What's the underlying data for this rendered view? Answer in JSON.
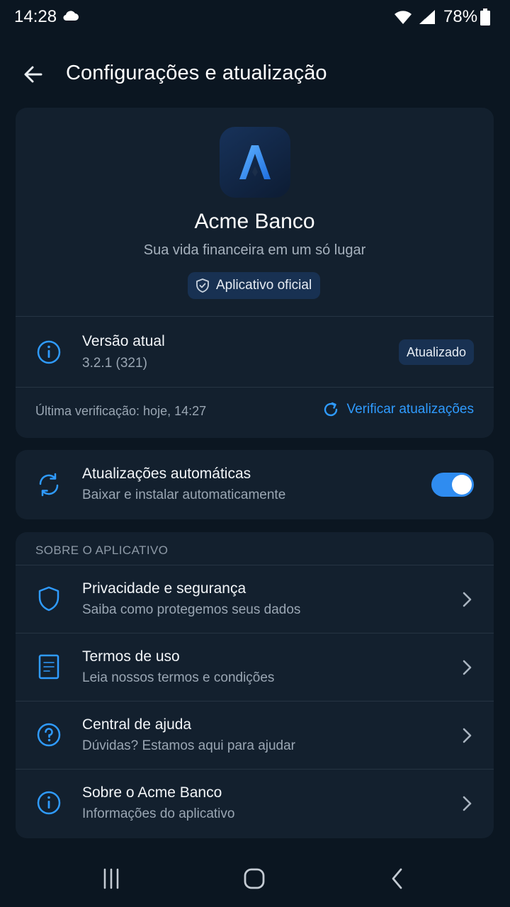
{
  "status_bar": {
    "time": "14:28",
    "battery": "78%"
  },
  "header": {
    "title": "Configurações e atualização"
  },
  "app": {
    "name": "Acme Banco",
    "tagline": "Sua vida financeira em um só lugar",
    "official_label": "Aplicativo oficial"
  },
  "version": {
    "title": "Versão atual",
    "value": "3.2.1 (321)",
    "status": "Atualizado",
    "last_check": "Última verificação: hoje, 14:27",
    "check_label": "Verificar atualizações"
  },
  "auto_updates": {
    "title": "Atualizações automáticas",
    "subtitle": "Baixar e instalar automaticamente",
    "enabled": true
  },
  "about": {
    "header": "SOBRE O APLICATIVO",
    "items": [
      {
        "title": "Privacidade e segurança",
        "subtitle": "Saiba como protegemos seus dados",
        "icon": "shield-icon"
      },
      {
        "title": "Termos de uso",
        "subtitle": "Leia nossos termos e condições",
        "icon": "document-icon"
      },
      {
        "title": "Central de ajuda",
        "subtitle": "Dúvidas? Estamos aqui para ajudar",
        "icon": "help-icon"
      },
      {
        "title": "Sobre o Acme Banco",
        "subtitle": "Informações do aplicativo",
        "icon": "info-icon"
      }
    ]
  },
  "colors": {
    "accent": "#2f9bff",
    "card": "#13202e",
    "background": "#0b1621"
  }
}
